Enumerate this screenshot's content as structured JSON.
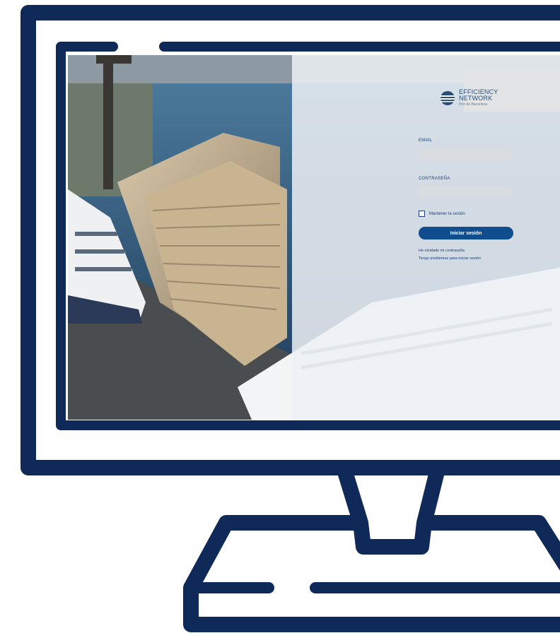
{
  "colors": {
    "frame": "#0f2958",
    "accent": "#0f4d8f",
    "overlay": "rgba(236,240,244,0.86)"
  },
  "icons": {
    "brand": "efficiency-network-logo",
    "monitor": "monitor-outline"
  },
  "brand": {
    "line1": "EFFICIENCY",
    "line2": "NETWORK",
    "sub": "Port de Barcelona"
  },
  "form": {
    "email_label": "EMAIL",
    "email_value": "",
    "password_label": "CONTRASEÑA",
    "password_value": "",
    "remember_label": "Mantener la sesión",
    "submit_label": "Iniciar sesión",
    "forgot_link": "He olvidado mi contraseña",
    "problems_link": "Tengo problemas para iniciar sesión"
  }
}
